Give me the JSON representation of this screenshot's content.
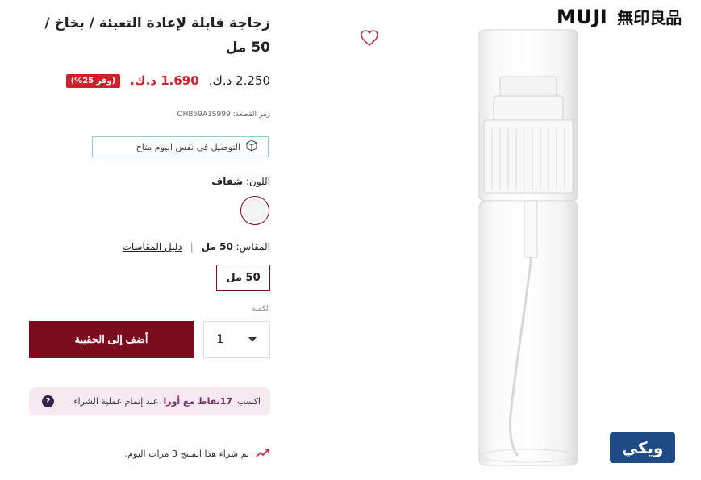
{
  "product": {
    "title": "زجاجة قابلة لإعادة التعبئة / بخاخ / 50 مل",
    "old_price": "2.250 د.ك.",
    "new_price": "1.690 د.ك.",
    "discount_badge": "(وفر 25%)",
    "sku_label": "رمز القطعة:",
    "sku": "OHB59A1S999",
    "delivery_text": "التوصيل في نفس اليوم متاح",
    "color_label": "اللون:",
    "color_value": "شفاف",
    "size_label": "المقاس:",
    "size_value": "50 مل",
    "size_guide": "دليل المقاسات",
    "size_option": "50 مل",
    "qty_label": "الكمية",
    "qty_value": "1",
    "add_to_bag": "أضف إلى الحقيبة",
    "points_prefix": "اكسب",
    "points_value": "17نقاط مع أورا",
    "points_suffix": "عند إتمام عملية الشراء",
    "help": "?",
    "trend_text": "تم شراء هذا المنتج 3 مرات اليوم."
  },
  "brand": {
    "latin": "MUJI",
    "cjk": "無印良品"
  },
  "badge": {
    "text": "ويكي"
  },
  "colors": {
    "accent": "#7a0c1e",
    "price": "#d0202a",
    "points_bg": "#f7e9f1",
    "badge_bg": "#1e4a86"
  }
}
